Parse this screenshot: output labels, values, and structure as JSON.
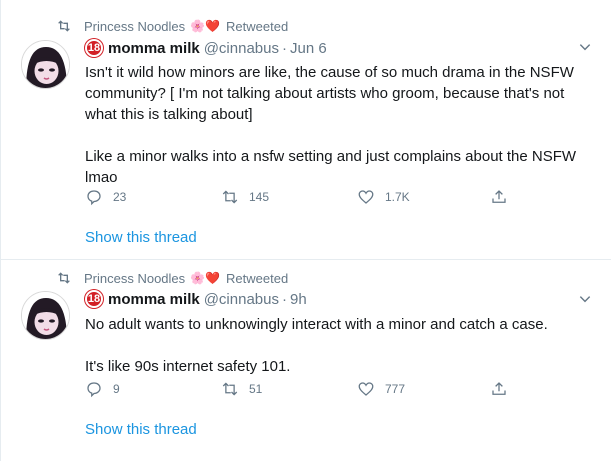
{
  "tweets": [
    {
      "retweeted_by": "Princess Noodles",
      "retweeted_emojis": "🌸❤️",
      "retweet_label": "Retweeted",
      "badge": "18",
      "display_name": "momma milk",
      "handle": "@cinnabus",
      "separator": "·",
      "time": "Jun 6",
      "paragraphs": [
        "Isn't it wild how minors are like, the cause of so much drama in the NSFW community? [ I'm not talking about artists who groom, because that's not what this is talking about]",
        "Like a minor walks into a nsfw setting and just complains about the NSFW lmao"
      ],
      "reply_count": "23",
      "retweet_count": "145",
      "like_count": "1.7K",
      "show_thread": "Show this thread"
    },
    {
      "retweeted_by": "Princess Noodles",
      "retweeted_emojis": "🌸❤️",
      "retweet_label": "Retweeted",
      "badge": "18",
      "display_name": "momma milk",
      "handle": "@cinnabus",
      "separator": "·",
      "time": "9h",
      "paragraphs": [
        "No adult wants to unknowingly interact with a minor and catch a case.",
        "It's like 90s internet safety 101."
      ],
      "reply_count": "9",
      "retweet_count": "51",
      "like_count": "777",
      "show_thread": "Show this thread"
    }
  ],
  "colors": {
    "text": "#14171a",
    "secondary": "#657786",
    "link": "#1b95e0",
    "border": "#e6ecf0",
    "badge": "#d21f25"
  },
  "icons": [
    "retweet-icon",
    "avatar-illustration",
    "caret-down-icon",
    "reply-icon",
    "retweet-action-icon",
    "like-icon",
    "share-icon"
  ]
}
